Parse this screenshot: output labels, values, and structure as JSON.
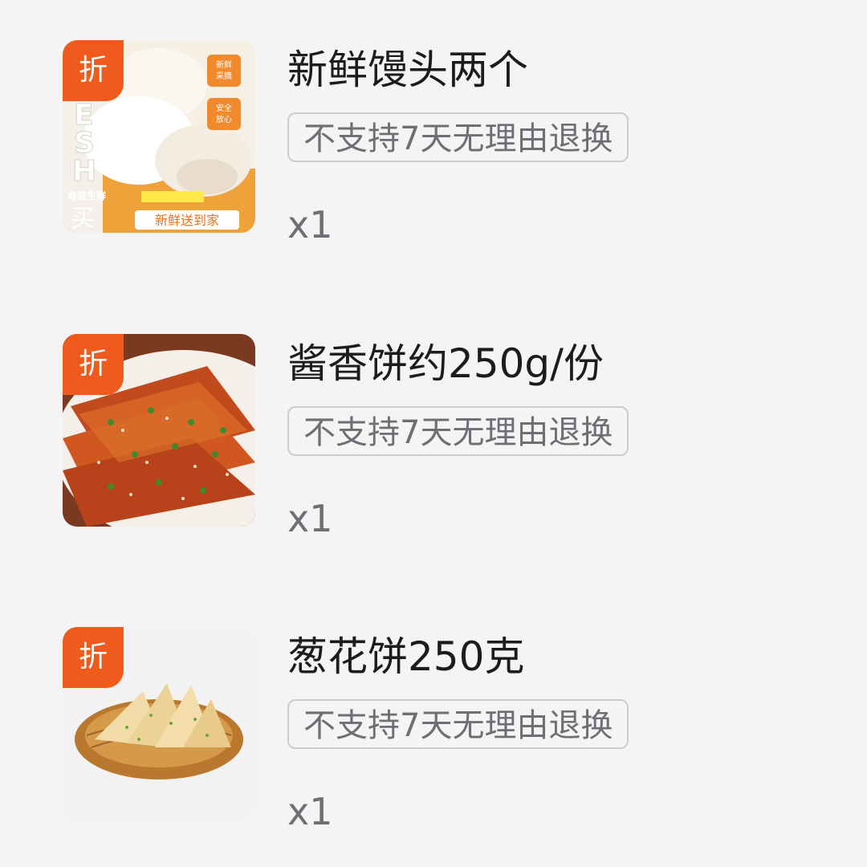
{
  "products": [
    {
      "tag": "折",
      "title": "新鲜馒头两个",
      "return_policy": "不支持7天无理由退换",
      "quantity": "x1",
      "image_text": {
        "brand": "ESH",
        "side_1": "新鲜采摘",
        "side_2": "安全放心",
        "store": "有家生鲜",
        "buy": "买",
        "banner": "新鲜送到家"
      }
    },
    {
      "tag": "折",
      "title": "酱香饼约250g/份",
      "return_policy": "不支持7天无理由退换",
      "quantity": "x1"
    },
    {
      "tag": "折",
      "title": "葱花饼250克",
      "return_policy": "不支持7天无理由退换",
      "quantity": "x1"
    }
  ],
  "colors": {
    "background": "#f4f4f4",
    "discount_tag": "#f05a1c",
    "badge_border": "#c9ccd2",
    "muted_text": "#6d6f74"
  },
  "icons": [
    "discount-tag",
    "mantou-image",
    "jiangxiang-bing-image",
    "conghua-bing-image"
  ]
}
